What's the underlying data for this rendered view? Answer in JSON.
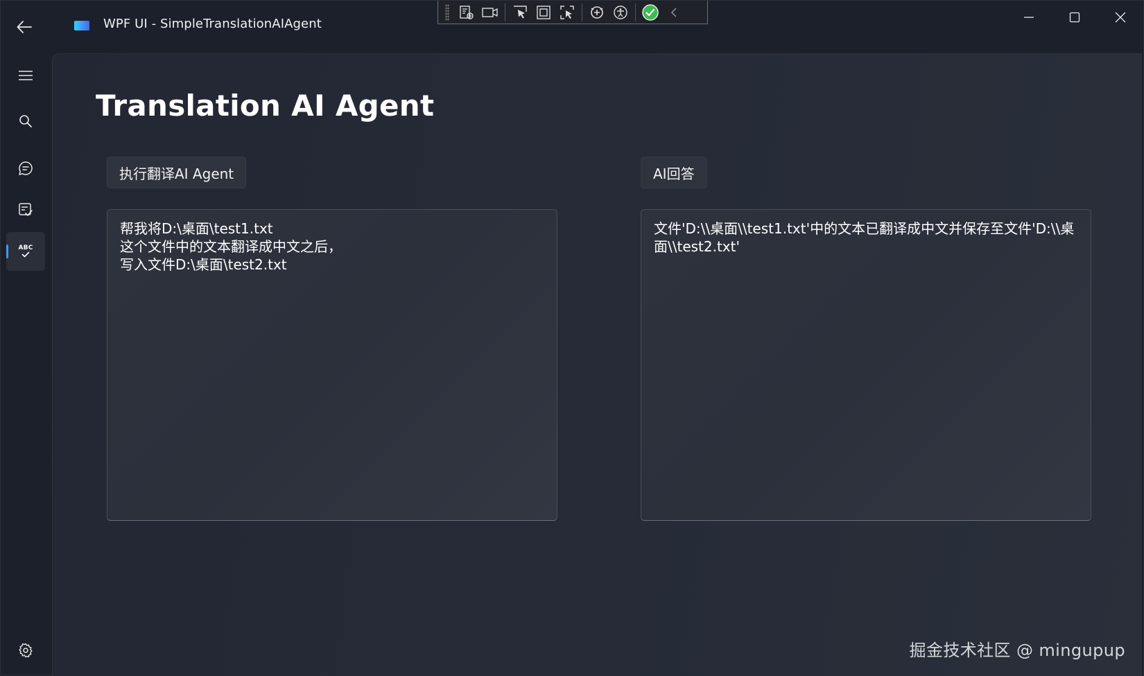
{
  "window": {
    "title": "WPF UI - SimpleTranslationAIAgent"
  },
  "sidebar": {
    "items": [
      {
        "name": "menu",
        "icon": "hamburger-icon"
      },
      {
        "name": "search",
        "icon": "search-icon"
      },
      {
        "name": "chat",
        "icon": "chat-icon"
      },
      {
        "name": "tasks",
        "icon": "checklist-icon"
      },
      {
        "name": "translation",
        "icon": "abc-check-icon",
        "label": "ABC",
        "active": true
      }
    ],
    "footer_icon": "gear-icon"
  },
  "page": {
    "title": "Translation AI Agent",
    "run_button_label": "执行翻译AI Agent",
    "answer_button_label": "AI回答",
    "input_text": "帮我将D:\\桌面\\test1.txt\n这个文件中的文本翻译成中文之后，\n写入文件D:\\桌面\\test2.txt",
    "answer_text": "文件'D:\\\\桌面\\\\test1.txt'中的文本已翻译成中文并保存至文件'D:\\\\桌面\\\\test2.txt'"
  },
  "watermark": "掘金技术社区 @ mingupup",
  "colors": {
    "accent": "#3b9bf0",
    "window_bg": "#1c202a",
    "content_bg": "#262b37",
    "button_bg": "#2f333e",
    "debug_check": "#3fb950"
  }
}
